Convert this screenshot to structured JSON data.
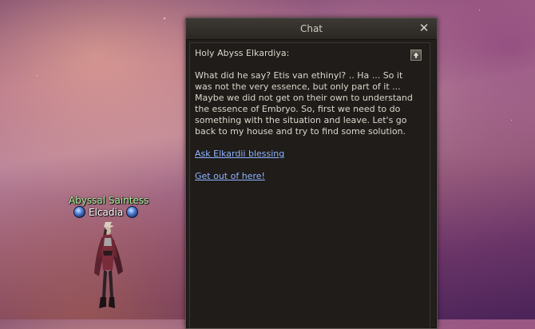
{
  "character": {
    "title": "Abyssal Saintess",
    "name": "Elcadia"
  },
  "chat": {
    "window_title": "Chat",
    "close_symbol": "✕",
    "speaker": "Holy Abyss Elkardiya:",
    "message": "What did he say? Etis van ethinyl? .. Ha ... So it was not the very essence, but only part of it ... Maybe we did not get on their own to understand the essence of Embryo. So, first we need to do something with the situation and leave. Let's go back to my house and try to find some solution.",
    "options": [
      {
        "label": "Ask Elkardii blessing"
      },
      {
        "label": "Get out of here!"
      }
    ]
  },
  "colors": {
    "title_text": "#a9f29b",
    "link": "#8fb4ff",
    "window_bg": "#211e1b"
  },
  "icons": {
    "close": "close-icon",
    "scroll": "scroll-up-arrow-icon",
    "orb": "blue-orb-icon"
  }
}
